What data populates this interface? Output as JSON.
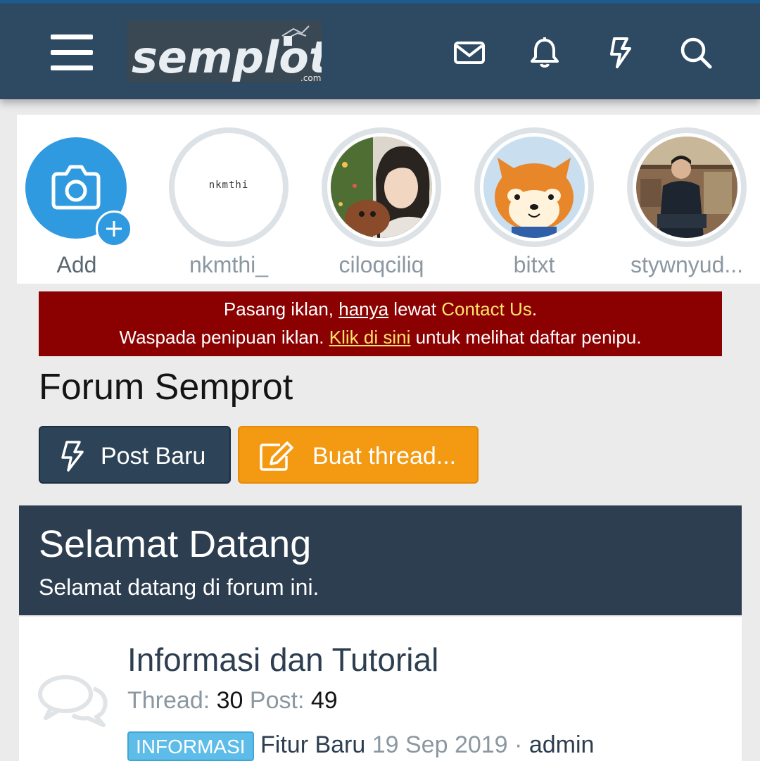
{
  "header": {
    "logo_text": "semplot",
    "logo_sub": ".com",
    "icons": [
      "menu-icon",
      "envelope-icon",
      "bell-icon",
      "bolt-icon",
      "search-icon"
    ]
  },
  "stories": [
    {
      "name": "Add",
      "type": "add",
      "icon": "camera-icon"
    },
    {
      "name": "nkmthi_",
      "type": "text-avatar",
      "avatar_text": "nkmthi"
    },
    {
      "name": "ciloqciliq",
      "type": "photo"
    },
    {
      "name": "bitxt",
      "type": "photo"
    },
    {
      "name": "stywnyud...",
      "type": "photo"
    }
  ],
  "notice": {
    "line1_a": "Pasang iklan, ",
    "line1_link": "hanya",
    "line1_b": " lewat ",
    "line1_contact": "Contact Us",
    "line1_c": ".",
    "line2_a": "Waspada penipuan iklan. ",
    "line2_link": "Klik di sini",
    "line2_b": " untuk melihat daftar penipu."
  },
  "page": {
    "title": "Forum Semprot"
  },
  "actions": {
    "post_baru": "Post Baru",
    "buat_thread": "Buat thread..."
  },
  "welcome": {
    "title": "Selamat Datang",
    "subtitle": "Selamat datang di forum ini."
  },
  "forum": {
    "title": "Informasi dan Tutorial",
    "thread_label": "Thread:",
    "thread_count": "30",
    "post_label": "Post:",
    "post_count": "49",
    "badge": "INFORMASI",
    "latest_title": "Fitur Baru",
    "latest_date": "19 Sep 2019",
    "separator": "·",
    "latest_user": "admin"
  },
  "colors": {
    "header_bg": "#2d4a62",
    "notice_bg": "#8b0000",
    "post_button": "#2d4358",
    "thread_button": "#f39a12",
    "welcome_bg": "#2d3e50",
    "badge": "#5dbde8"
  }
}
